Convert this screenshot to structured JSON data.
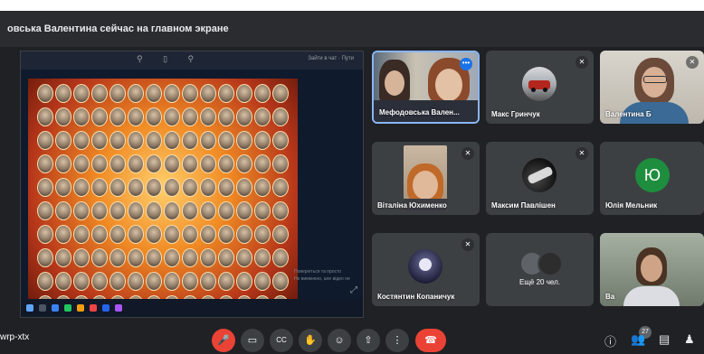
{
  "presenter_banner": "овська Валентина сейчас на главном экране",
  "shared_screen": {
    "toolbar_links": "Зайти в чат   ·   Пути",
    "caption_lines": [
      "Поверніться та просто",
      "Не вимкнено, але відео не"
    ]
  },
  "tiles": [
    {
      "name": "Мефодовська Вален...",
      "type": "camera"
    },
    {
      "name": "Макс Гринчук",
      "type": "avatar"
    },
    {
      "name": "Валентина Б",
      "type": "camera"
    },
    {
      "name": "Віталіна Юхименко",
      "type": "camera"
    },
    {
      "name": "Максим Павлішен",
      "type": "avatar"
    },
    {
      "name": "Юлія Мельник",
      "type": "initial",
      "initial": "Ю",
      "color": "#1e8e3e"
    },
    {
      "name": "Костянтин Копаничук",
      "type": "avatar"
    },
    {
      "name": "",
      "type": "more",
      "more_label": "Ещё 20 чел."
    },
    {
      "name": "Ва",
      "type": "camera"
    }
  ],
  "bottom_bar": {
    "meeting_code": "wrp-xtx",
    "participants_count": "27",
    "controls": {
      "mic": "🎤",
      "camera": "▭",
      "captions": "CC",
      "raise_hand": "✋",
      "emoji": "☺",
      "present": "⇧",
      "more": "⋮",
      "end_call": "☎"
    },
    "right": {
      "info": "ⓘ",
      "people": "👥",
      "chat": "▤",
      "activities": "♟"
    }
  },
  "colors": {
    "background": "#202124",
    "tile": "#3c4043",
    "end_call": "#ea4335",
    "active_border": "#8ab4f8"
  }
}
